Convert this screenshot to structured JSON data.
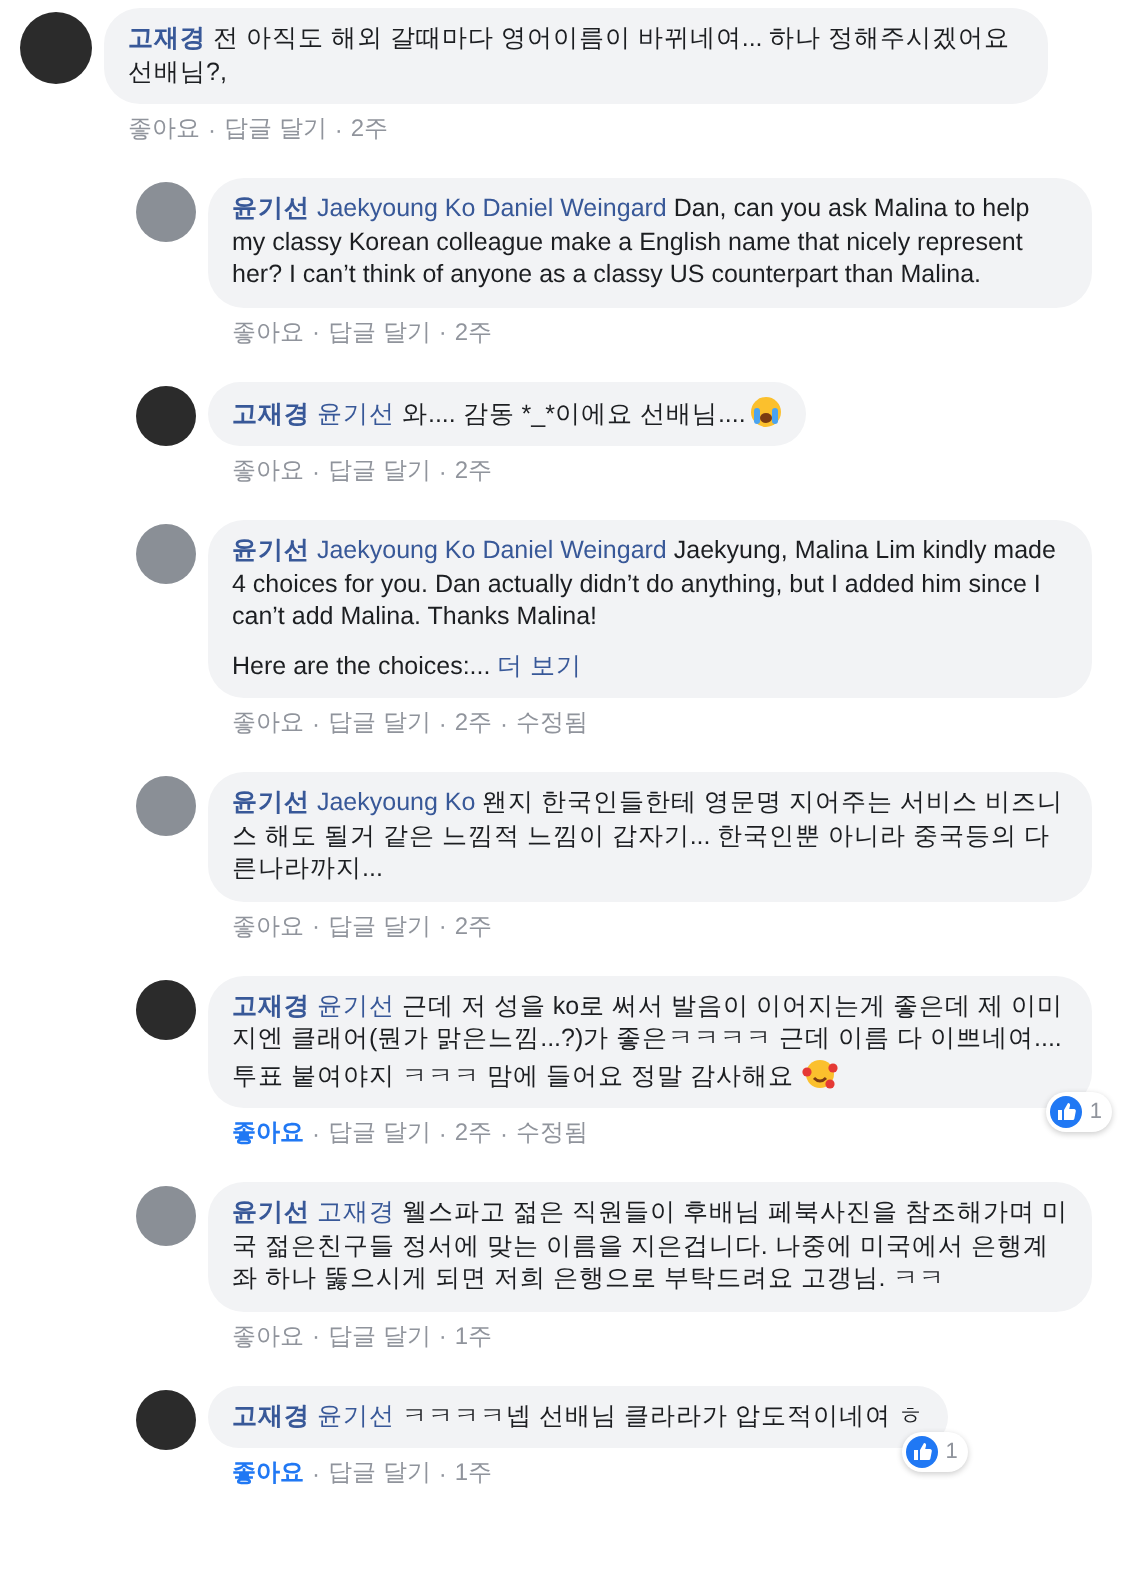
{
  "separator": "·",
  "comment": {
    "color": "#2b2b2b",
    "author": "고재경",
    "paragraphs": [
      "전 아직도 해외 갈때마다 영어이름이 바뀌네여... 하나 정해주시겠어요 선배님?,"
    ],
    "actions": {
      "like": "좋아요",
      "liked": false,
      "reply": "답글 달기",
      "time": "2주"
    },
    "replies": [
      {
        "color": "#8a8f96",
        "author": "윤기선",
        "mentions": [
          "Jaekyoung Ko",
          "Daniel Weingard"
        ],
        "paragraphs": [
          "Dan, can you ask Malina to help my classy Korean colleague make a English name that nicely represent her? I can’t think of anyone as a classy US counterpart than Malina."
        ],
        "actions": {
          "like": "좋아요",
          "liked": false,
          "reply": "답글 달기",
          "time": "2주"
        }
      },
      {
        "color": "#2b2b2b",
        "author": "고재경",
        "mentions": [
          "윤기선"
        ],
        "paragraphs": [
          "와.... 감동 *_*이에요 선배님...."
        ],
        "emoji": {
          "kind": "crying"
        },
        "actions": {
          "like": "좋아요",
          "liked": false,
          "reply": "답글 달기",
          "time": "2주"
        }
      },
      {
        "color": "#8a8f96",
        "author": "윤기선",
        "mentions": [
          "Jaekyoung Ko",
          "Daniel Weingard"
        ],
        "paragraphs": [
          "Jaekyung, Malina Lim kindly made 4 choices for you. Dan actually didn’t do anything, but I added him since I can’t add Malina. Thanks Malina!",
          "Here are the choices:..."
        ],
        "more": "더 보기",
        "actions": {
          "like": "좋아요",
          "liked": false,
          "reply": "답글 달기",
          "time": "2주",
          "edited": "수정됨"
        }
      },
      {
        "color": "#8a8f96",
        "author": "윤기선",
        "mentions": [
          "Jaekyoung Ko"
        ],
        "paragraphs": [
          "왠지 한국인들한테 영문명 지어주는 서비스 비즈니스 해도 될거 같은 느낌적 느낌이 갑자기... 한국인뿐 아니라 중국등의 다른나라까지..."
        ],
        "actions": {
          "like": "좋아요",
          "liked": false,
          "reply": "답글 달기",
          "time": "2주"
        }
      },
      {
        "color": "#2b2b2b",
        "author": "고재경",
        "mentions": [
          "윤기선"
        ],
        "paragraphs": [
          "근데 저 성을 ko로 써서 발음이 이어지는게 좋은데 제 이미지엔 클래어(뭔가 맑은느낌...?)가 좋은ㅋㅋㅋㅋ 근데 이름 다 이쁘네여.... 투표 붙여야지 ㅋㅋㅋ 맘에 들어요 정말 감사해요"
        ],
        "emoji": {
          "kind": "hearts"
        },
        "reactions": "1",
        "actions": {
          "like": "좋아요",
          "liked": true,
          "reply": "답글 달기",
          "time": "2주",
          "edited": "수정됨"
        }
      },
      {
        "color": "#8a8f96",
        "author": "윤기선",
        "mentions": [
          "고재경"
        ],
        "paragraphs": [
          "웰스파고 젊은 직원들이 후배님 페북사진을 참조해가며 미국 젊은친구들 정서에 맞는 이름을 지은겁니다. 나중에 미국에서 은행계좌 하나 뚫으시게 되면 저희 은행으로 부탁드려요 고갱님. ㅋㅋ"
        ],
        "actions": {
          "like": "좋아요",
          "liked": false,
          "reply": "답글 달기",
          "time": "1주"
        }
      },
      {
        "color": "#2b2b2b",
        "author": "고재경",
        "mentions": [
          "윤기선"
        ],
        "paragraphs": [
          "ㅋㅋㅋㅋ넵 선배님 클라라가 압도적이네여 ㅎ"
        ],
        "reactions": "1",
        "actions": {
          "like": "좋아요",
          "liked": true,
          "reply": "답글 달기",
          "time": "1주"
        }
      }
    ]
  }
}
